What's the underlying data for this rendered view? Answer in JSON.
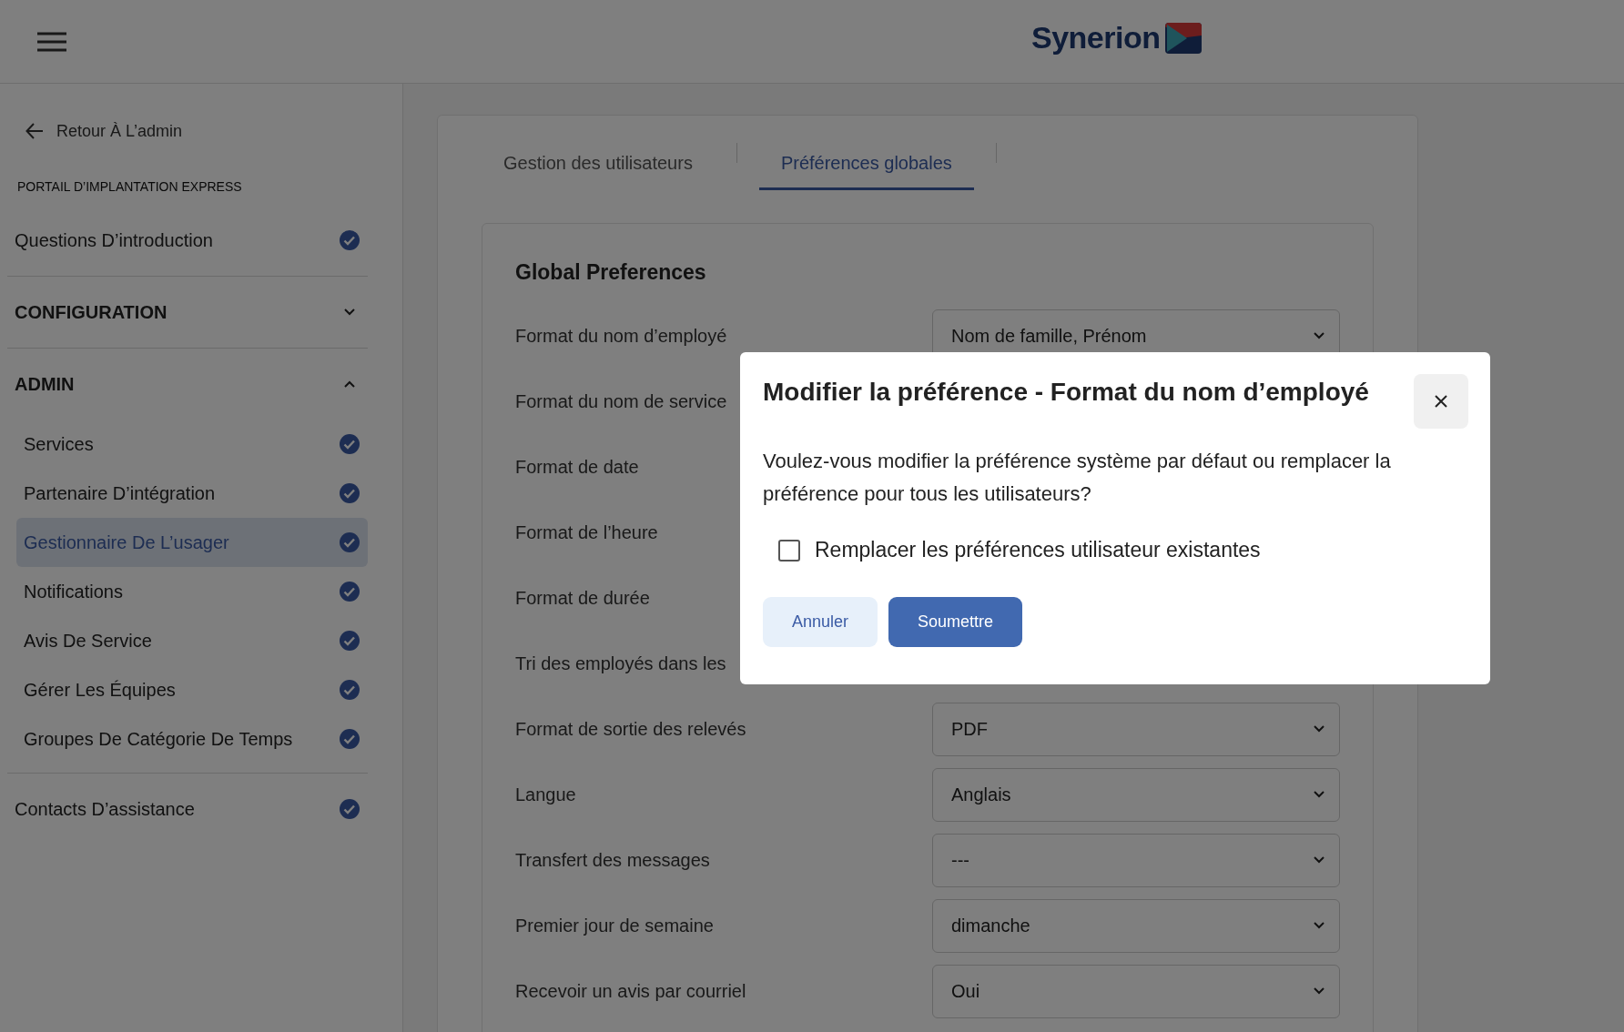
{
  "header": {
    "brand": "Synerion"
  },
  "sidebar": {
    "back_link": "Retour À L’admin",
    "portal_title": "PORTAIL D’IMPLANTATION EXPRESS",
    "groups": [
      {
        "kind": "item",
        "label": "Questions D’introduction",
        "completed": true,
        "selected": false
      },
      {
        "kind": "section",
        "label": "CONFIGURATION",
        "expanded": false
      },
      {
        "kind": "section",
        "label": "ADMIN",
        "expanded": true,
        "children": [
          {
            "label": "Services",
            "completed": true,
            "selected": false
          },
          {
            "label": "Partenaire D’intégration",
            "completed": true,
            "selected": false
          },
          {
            "label": "Gestionnaire De L’usager",
            "completed": true,
            "selected": true
          },
          {
            "label": "Notifications",
            "completed": true,
            "selected": false
          },
          {
            "label": "Avis De Service",
            "completed": true,
            "selected": false
          },
          {
            "label": "Gérer Les Équipes",
            "completed": true,
            "selected": false
          },
          {
            "label": "Groupes De Catégorie De Temps",
            "completed": true,
            "selected": false
          }
        ]
      },
      {
        "kind": "item",
        "label": "Contacts D’assistance",
        "completed": true,
        "selected": false
      }
    ]
  },
  "tabs": [
    {
      "label": "Gestion des utilisateurs",
      "selected": false
    },
    {
      "label": "Préférences globales",
      "selected": true
    }
  ],
  "preferences": {
    "title": "Global Preferences",
    "rows": [
      {
        "label": "Format du nom d’employé",
        "value": "Nom de famille, Prénom"
      },
      {
        "label": "Format du nom de service"
      },
      {
        "label": "Format de date"
      },
      {
        "label": "Format de l’heure"
      },
      {
        "label": "Format de durée"
      },
      {
        "label": "Tri des employés dans les"
      },
      {
        "label": "Format de sortie des relevés",
        "value": "PDF"
      },
      {
        "label": "Langue",
        "value": "Anglais"
      },
      {
        "label": "Transfert des messages",
        "value": "---"
      },
      {
        "label": "Premier jour de semaine",
        "value": "dimanche"
      },
      {
        "label": "Recevoir un avis par courriel",
        "value": "Oui"
      }
    ]
  },
  "dialog": {
    "title": "Modifier la préférence - Format du nom d’employé",
    "message": "Voulez-vous modifier la préférence système par défaut ou remplacer la préférence pour tous les utilisateurs?",
    "checkbox": {
      "label": "Remplacer les préférences utilisateur existantes",
      "checked": false
    },
    "buttons": [
      {
        "kind": "secondary",
        "label": "Annuler"
      },
      {
        "kind": "primary",
        "label": "Soumettre"
      }
    ]
  }
}
